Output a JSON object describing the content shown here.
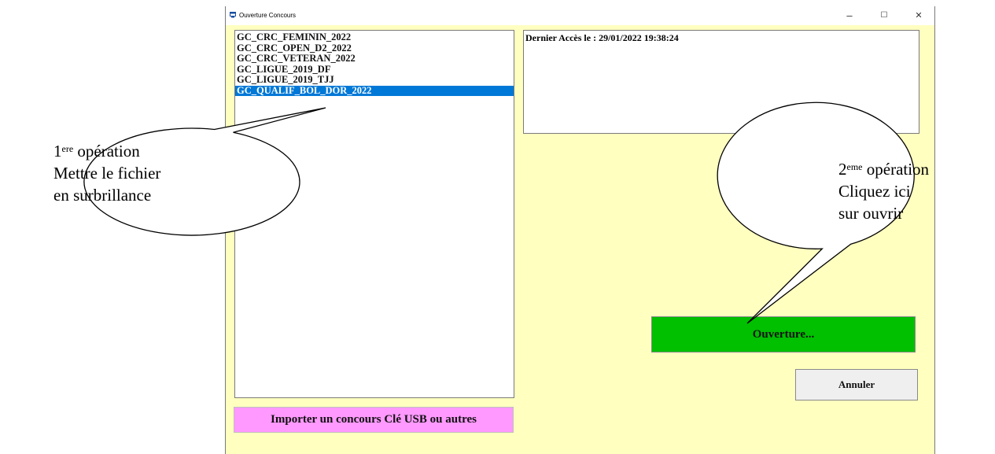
{
  "window": {
    "title": "Ouverture Concours",
    "controls": {
      "minimize": "–",
      "maximize": "☐",
      "close": "✕"
    }
  },
  "file_list": {
    "items": [
      {
        "label": "GC_CRC_FEMININ_2022",
        "selected": false
      },
      {
        "label": "GC_CRC_OPEN_D2_2022",
        "selected": false
      },
      {
        "label": "GC_CRC_VETERAN_2022",
        "selected": false
      },
      {
        "label": "GC_LIGUE_2019_DF",
        "selected": false
      },
      {
        "label": "GC_LIGUE_2019_TJJ",
        "selected": false
      },
      {
        "label": "GC_QUALIF_BOL_DOR_2022",
        "selected": true
      }
    ]
  },
  "info_panel": {
    "text": "Dernier Accès le : 29/01/2022 19:38:24"
  },
  "buttons": {
    "import": "Importer un concours Clé USB ou autres",
    "open": "Ouverture...",
    "cancel": "Annuler"
  },
  "callouts": {
    "first": {
      "num": "1",
      "sup": "ere",
      "word": " opération",
      "line2": "Mettre le fichier",
      "line3": "en surbrillance"
    },
    "second": {
      "num": "2",
      "sup": "eme",
      "word": " opération",
      "line2": "Cliquez ici",
      "line3": "sur ouvrir"
    }
  },
  "colors": {
    "window_bg": "#ffffc0",
    "selection": "#0078d7",
    "open_button": "#00c000",
    "import_button": "#ff99ff",
    "cancel_button": "#efefef"
  }
}
